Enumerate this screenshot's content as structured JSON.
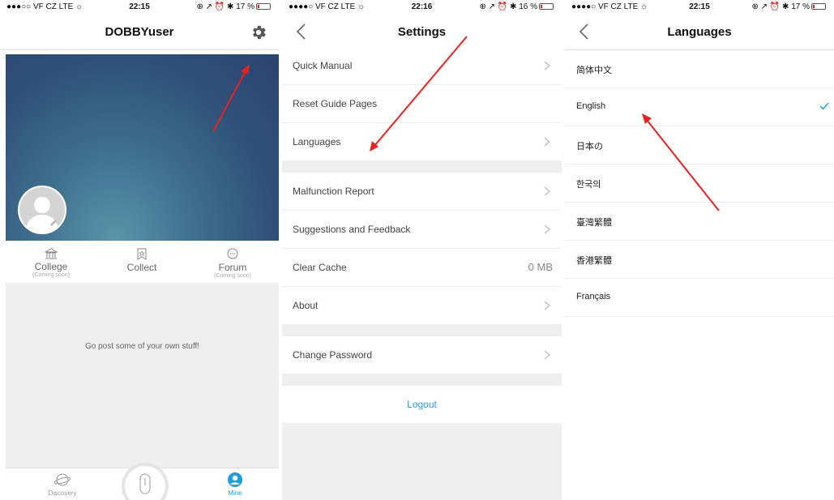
{
  "status_bars": [
    {
      "carrier": "●●●○○ VF CZ  LTE ☼",
      "time": "22:15",
      "right": "⊕ ↗ ⏰ ✱ 17 %"
    },
    {
      "carrier": "●●●●○ VF CZ  LTE ☼",
      "time": "22:16",
      "right": "⊕ ↗ ⏰ ✱ 16 %"
    },
    {
      "carrier": "●●●●○ VF CZ  LTE ☼",
      "time": "22:15",
      "right": "⊕ ↗ ⏰ ✱ 17 %"
    }
  ],
  "battery_levels": [
    0.17,
    0.16,
    0.17
  ],
  "profile": {
    "title": "DOBBYuser",
    "tabs": [
      {
        "label": "College",
        "sub": "(Coming soon)",
        "icon": "bank-icon"
      },
      {
        "label": "Collect",
        "sub": "",
        "icon": "bookmark-icon"
      },
      {
        "label": "Forum",
        "sub": "(Coming soon)",
        "icon": "chat-bubble-icon"
      }
    ],
    "empty_message": "Go post some of your own stuff!",
    "bottom_nav": [
      {
        "label": "Discovery",
        "icon": "planet-icon"
      },
      {
        "label": "Mine",
        "icon": "person-icon",
        "active": true
      }
    ],
    "accent": "#1aa0e0"
  },
  "settings": {
    "title": "Settings",
    "group1": [
      "Quick Manual",
      "Reset Guide Pages",
      "Languages"
    ],
    "group2": [
      "Malfunction Report",
      "Suggestions and Feedback",
      "Clear Cache",
      "About"
    ],
    "cache_value": "0 MB",
    "group3": [
      "Change Password"
    ],
    "logout": "Logout"
  },
  "languages": {
    "title": "Languages",
    "items": [
      "简体中文",
      "English",
      "日本の",
      "한국의",
      "臺灣繁體",
      "香港繁體",
      "Français"
    ],
    "selected": "English"
  },
  "annotation_color": "#e8231f"
}
